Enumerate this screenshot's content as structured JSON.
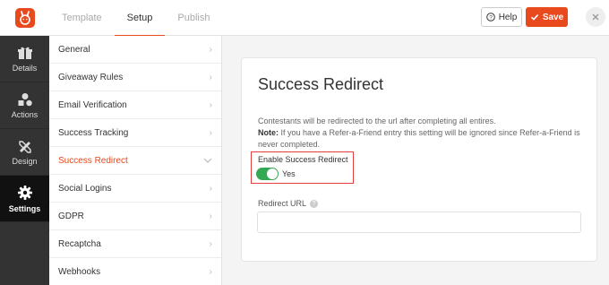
{
  "header": {
    "tabs": [
      {
        "label": "Template"
      },
      {
        "label": "Setup"
      },
      {
        "label": "Publish"
      }
    ],
    "help_label": "Help",
    "save_label": "Save",
    "accent_color": "#e8491d"
  },
  "leftnav": {
    "items": [
      {
        "label": "Details",
        "icon": "gift-icon"
      },
      {
        "label": "Actions",
        "icon": "shapes-icon"
      },
      {
        "label": "Design",
        "icon": "design-tools-icon"
      },
      {
        "label": "Settings",
        "icon": "gear-icon"
      }
    ]
  },
  "settings_menu": {
    "items": [
      {
        "label": "General"
      },
      {
        "label": "Giveaway Rules"
      },
      {
        "label": "Email Verification"
      },
      {
        "label": "Success Tracking"
      },
      {
        "label": "Success Redirect"
      },
      {
        "label": "Social Logins"
      },
      {
        "label": "GDPR"
      },
      {
        "label": "Recaptcha"
      },
      {
        "label": "Webhooks"
      }
    ]
  },
  "panel": {
    "title": "Success Redirect",
    "description": "Contestants will be redirected to the url after completing all entires.",
    "note_label": "Note:",
    "note_text": " If you have a Refer-a-Friend entry this setting will be ignored since Refer-a-Friend is never completed.",
    "toggle_label": "Enable Success Redirect",
    "toggle_value": "Yes",
    "toggle_on_color": "#34a853",
    "redirect_url_label": "Redirect URL",
    "redirect_url_value": ""
  }
}
